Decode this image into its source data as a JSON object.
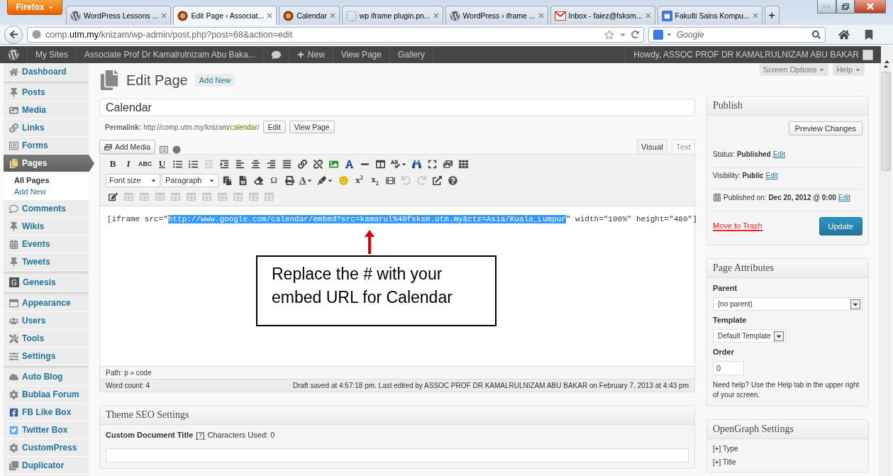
{
  "browser": {
    "menu_button": "Firefox",
    "tabs": [
      {
        "title": "WordPress Lessons ...",
        "kind": "wordpress",
        "selected": false
      },
      {
        "title": "Edit Page ‹ Associat...",
        "kind": "medal",
        "selected": true
      },
      {
        "title": "Calendar",
        "kind": "medal",
        "selected": false
      },
      {
        "title": "wp iframe plugin.pn...",
        "kind": "dashed",
        "selected": false
      },
      {
        "title": "WordPress › iframe ...",
        "kind": "wordpress",
        "selected": false
      },
      {
        "title": "Inbox - faiez@fsksm...",
        "kind": "mail",
        "selected": false
      },
      {
        "title": "Fakulti Sains Kompu...",
        "kind": "calendar",
        "selected": false
      }
    ],
    "new_tab": "+",
    "url": "comp.**utm.my**/knizam/wp-admin/post.php?post=68&action=edit",
    "search_placeholder": "Google"
  },
  "admin_bar": {
    "items": [
      {
        "kind": "logo"
      },
      {
        "kind": "text",
        "label": "My Sites"
      },
      {
        "kind": "text",
        "label": "Associate Prof Dr Kamalrulnizam Abu Baka..."
      },
      {
        "kind": "comments"
      },
      {
        "kind": "new",
        "label": "New"
      },
      {
        "kind": "text",
        "label": "View Page"
      },
      {
        "kind": "text",
        "label": "Gallery"
      }
    ],
    "greeting": "Howdy, ASSOC PROF DR KAMALRULNIZAM ABU BAKAR"
  },
  "sidebar": {
    "groups": [
      [
        {
          "label": "Dashboard",
          "selected": false
        }
      ],
      [
        {
          "label": "Posts",
          "selected": false
        },
        {
          "label": "Media",
          "selected": false
        },
        {
          "label": "Links",
          "selected": false
        },
        {
          "label": "Forms",
          "selected": false
        },
        {
          "label": "Pages",
          "selected": true,
          "children": [
            {
              "label": "All Pages",
              "selected": true
            },
            {
              "label": "Add New",
              "selected": false
            }
          ]
        },
        {
          "label": "Comments",
          "selected": false
        },
        {
          "label": "Wikis",
          "selected": false
        },
        {
          "label": "Events",
          "selected": false
        },
        {
          "label": "Tweets",
          "selected": false
        }
      ],
      [
        {
          "label": "Genesis",
          "letter": "G",
          "selected": false
        }
      ],
      [
        {
          "label": "Appearance",
          "selected": false
        },
        {
          "label": "Users",
          "selected": false
        },
        {
          "label": "Tools",
          "selected": false
        },
        {
          "label": "Settings",
          "selected": false
        }
      ],
      [
        {
          "label": "Auto Blog",
          "selected": false
        },
        {
          "label": "Bublaa Forum",
          "selected": false
        },
        {
          "label": "FB Like Box",
          "selected": false
        },
        {
          "label": "Twitter Box",
          "selected": false
        },
        {
          "label": "CustomPress",
          "selected": false
        },
        {
          "label": "Duplicator",
          "selected": false
        }
      ]
    ]
  },
  "header": {
    "title": "Edit Page",
    "add_new": "Add New",
    "screen_options": "Screen Options",
    "help": "Help"
  },
  "post": {
    "title": "Calendar",
    "permalink": {
      "label": "Permalink:",
      "base": "http://comp.utm.my/knizam/",
      "slug": "calendar",
      "trail": "/"
    },
    "permalink_buttons": [
      "Edit",
      "View Page"
    ],
    "add_media": "Add Media",
    "editor_tabs": [
      {
        "label": "Visual",
        "selected": true
      },
      {
        "label": "Text",
        "selected": false
      }
    ],
    "toolbar_rows": [
      [
        {
          "kind": "bold",
          "label": "B"
        },
        {
          "kind": "italic",
          "label": "I"
        },
        {
          "kind": "strike",
          "label": "ABC"
        },
        {
          "kind": "underline",
          "label": "U"
        },
        {
          "kind": "icon",
          "disabled": false
        },
        {
          "kind": "icon",
          "disabled": false
        },
        {
          "kind": "icon",
          "disabled": true
        },
        {
          "kind": "icon",
          "disabled": false
        },
        {
          "kind": "icon",
          "disabled": false
        },
        {
          "kind": "icon",
          "disabled": false
        },
        {
          "kind": "icon",
          "disabled": false
        },
        {
          "kind": "icon",
          "disabled": false
        },
        {
          "kind": "icon",
          "disabled": false
        },
        {
          "kind": "icon",
          "disabled": false
        },
        {
          "kind": "icon",
          "disabled": false
        },
        {
          "kind": "icon",
          "disabled": false
        },
        {
          "kind": "icon",
          "disabled": false
        },
        {
          "kind": "icon",
          "disabled": false
        },
        {
          "kind": "icon",
          "disabled": false,
          "caret": true
        },
        {
          "kind": "icon",
          "disabled": false
        },
        {
          "kind": "icon",
          "disabled": false
        },
        {
          "kind": "icon",
          "disabled": false
        },
        {
          "kind": "icon",
          "disabled": false
        }
      ],
      [
        {
          "kind": "select",
          "label": "Font size"
        },
        {
          "kind": "select",
          "label": "Paragraph"
        },
        {
          "kind": "icon",
          "disabled": false
        },
        {
          "kind": "icon",
          "disabled": false
        },
        {
          "kind": "icon",
          "disabled": false
        },
        {
          "kind": "symbol",
          "label": "Ω"
        },
        {
          "kind": "icon",
          "disabled": false
        },
        {
          "kind": "underline",
          "label": "A",
          "caret": true
        },
        {
          "kind": "icon",
          "disabled": false,
          "caret": true
        },
        {
          "kind": "icon",
          "disabled": false
        },
        {
          "kind": "bold",
          "label": "x$^{2}$"
        },
        {
          "kind": "bold",
          "label": "x$_{2}$"
        },
        {
          "kind": "icon",
          "disabled": false
        },
        {
          "kind": "icon",
          "disabled": true
        },
        {
          "kind": "icon",
          "disabled": true
        },
        {
          "kind": "icon",
          "disabled": false
        },
        {
          "kind": "icon",
          "disabled": false
        }
      ],
      [
        {
          "kind": "icon",
          "disabled": false
        },
        {
          "kind": "icon",
          "disabled": true
        },
        {
          "kind": "icon",
          "disabled": true
        },
        {
          "kind": "icon",
          "disabled": true
        },
        {
          "kind": "icon",
          "disabled": true
        },
        {
          "kind": "icon",
          "disabled": true
        },
        {
          "kind": "icon",
          "disabled": true
        },
        {
          "kind": "icon",
          "disabled": true
        },
        {
          "kind": "icon",
          "disabled": true
        },
        {
          "kind": "icon",
          "disabled": true
        },
        {
          "kind": "icon",
          "disabled": true
        }
      ]
    ],
    "content": {
      "before": "[iframe src=\"",
      "selected": "http://www.google.com/calendar/embed?src=kamarul%40fsksm.utm.my&ctz=Asia/Kuala_Lumpur",
      "after": "\" width=\"100%\" height=\"480\"]"
    },
    "annotation": "Replace the # with  your embed URL for Calendar",
    "path": "Path: p » code",
    "word_count": "Word count: 4",
    "draft_status": "Draft saved at 4:57:18 pm. Last edited by ASSOC PROF DR KAMALRULNIZAM ABU BAKAR on February 7, 2013 at 4:43 pm"
  },
  "seo_box": {
    "title": "Theme SEO Settings",
    "field_label": "Custom Document Title",
    "help_link": "[?]",
    "counter": "Characters Used: 0"
  },
  "publish": {
    "title": "Publish",
    "preview": "Preview Changes",
    "status": "Status: **Published**",
    "visibility": "Visibility: **Public**",
    "published_on": "Published on: **Dec 20, 2012 @ 0:00**",
    "status_edit": "Edit",
    "visibility_edit": "Edit",
    "date_edit": "Edit",
    "trash": "Move to Trash",
    "update": "Update"
  },
  "page_attributes": {
    "title": "Page Attributes",
    "parent_label": "Parent",
    "parent": "(no parent)",
    "template_label": "Template",
    "template": "Default Template",
    "order_label": "Order",
    "order": "0",
    "help": "Need help? Use the Help tab in the upper right of your screen."
  },
  "opengraph": {
    "title": "OpenGraph Settings",
    "items": [
      "[+] Type",
      "[+] Title"
    ]
  }
}
